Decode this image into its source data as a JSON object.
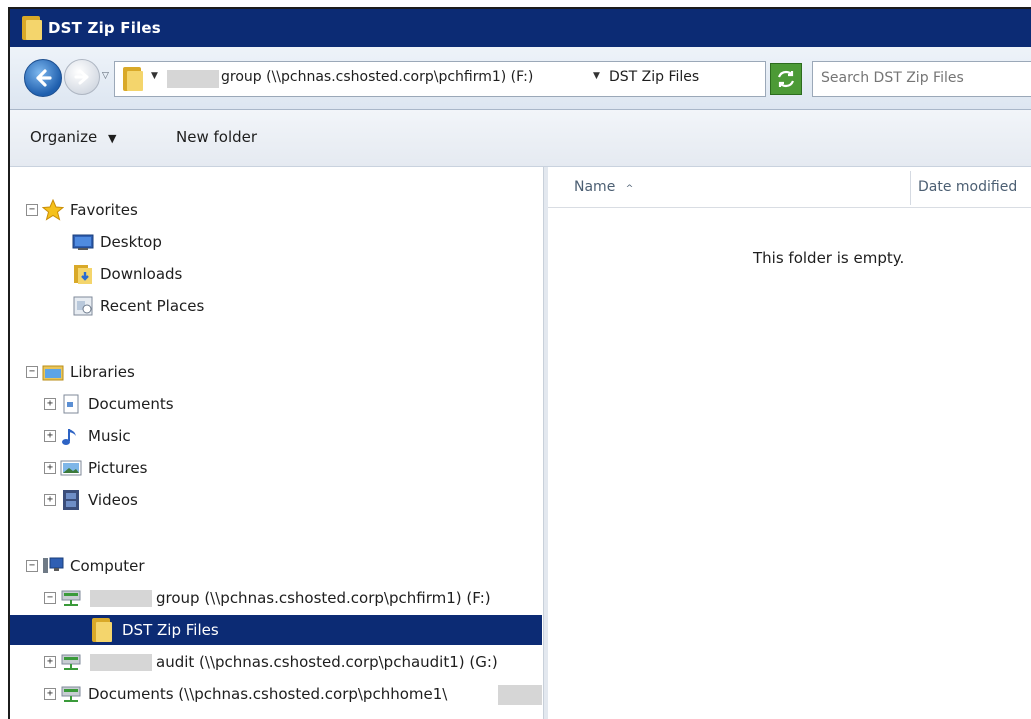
{
  "window": {
    "title": "DST Zip Files"
  },
  "address_bar": {
    "drive_label": "group (\\\\pchnas.cshosted.corp\\pchfirm1) (F:)",
    "current_folder": "DST Zip Files"
  },
  "search": {
    "placeholder": "Search DST Zip Files"
  },
  "toolbar": {
    "organize_label": "Organize",
    "new_folder_label": "New folder"
  },
  "nav": {
    "favorites": {
      "label": "Favorites",
      "items": [
        "Desktop",
        "Downloads",
        "Recent Places"
      ]
    },
    "libraries": {
      "label": "Libraries",
      "items": [
        "Documents",
        "Music",
        "Pictures",
        "Videos"
      ]
    },
    "computer": {
      "label": "Computer",
      "drives": [
        "group (\\\\pchnas.cshosted.corp\\pchfirm1) (F:)",
        "audit (\\\\pchnas.cshosted.corp\\pchaudit1) (G:)",
        "Documents (\\\\pchnas.cshosted.corp\\pchhome1\\"
      ],
      "selected_folder": "DST Zip Files"
    }
  },
  "content": {
    "columns": [
      "Name",
      "Date modified"
    ],
    "empty_message": "This folder is empty."
  },
  "colors": {
    "title_bar": "#0c2b74",
    "selection": "#0c2b74",
    "folder": "#f4d56c"
  }
}
